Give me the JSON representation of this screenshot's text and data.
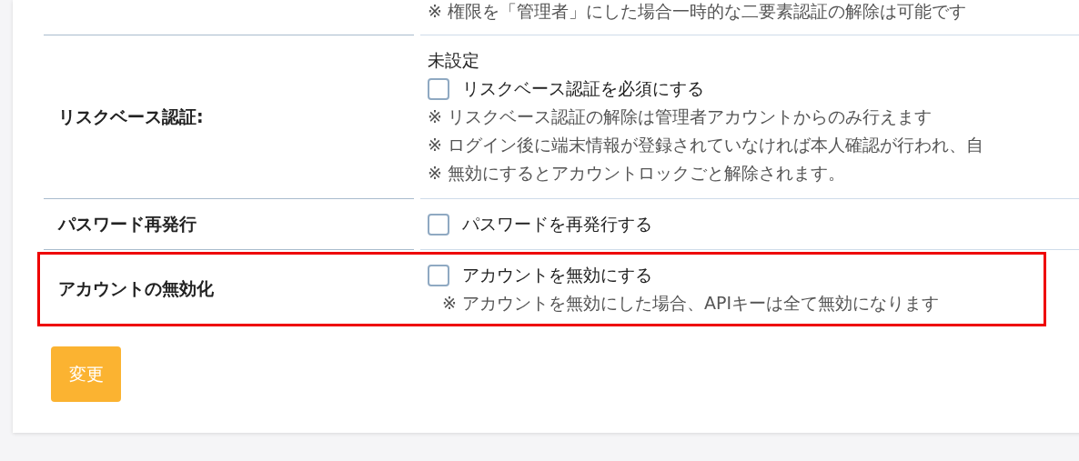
{
  "rows": [
    {
      "kind": "notes_only",
      "notes": [
        "※ 権限を「管理者」にした場合一時的な二要素認証の解除は可能です"
      ]
    },
    {
      "kind": "setting",
      "label": "リスクベース認証:",
      "status": "未設定",
      "checkbox": {
        "label": "リスクベース認証を必須にする",
        "checked": false
      },
      "notes": [
        "※ リスクベース認証の解除は管理者アカウントからのみ行えます",
        "※ ログイン後に端末情報が登録されていなければ本人確認が行われ、自",
        "※ 無効にするとアカウントロックごと解除されます。"
      ],
      "highlighted": false
    },
    {
      "kind": "setting",
      "label": "パスワード再発行",
      "checkbox": {
        "label": "パスワードを再発行する",
        "checked": false
      },
      "highlighted": false
    },
    {
      "kind": "setting",
      "label": "アカウントの無効化",
      "checkbox": {
        "label": "アカウントを無効にする",
        "checked": false
      },
      "notes": [
        "※ アカウントを無効にした場合、APIキーは全て無効になります"
      ],
      "highlighted": true
    }
  ],
  "submit_button": "変更"
}
